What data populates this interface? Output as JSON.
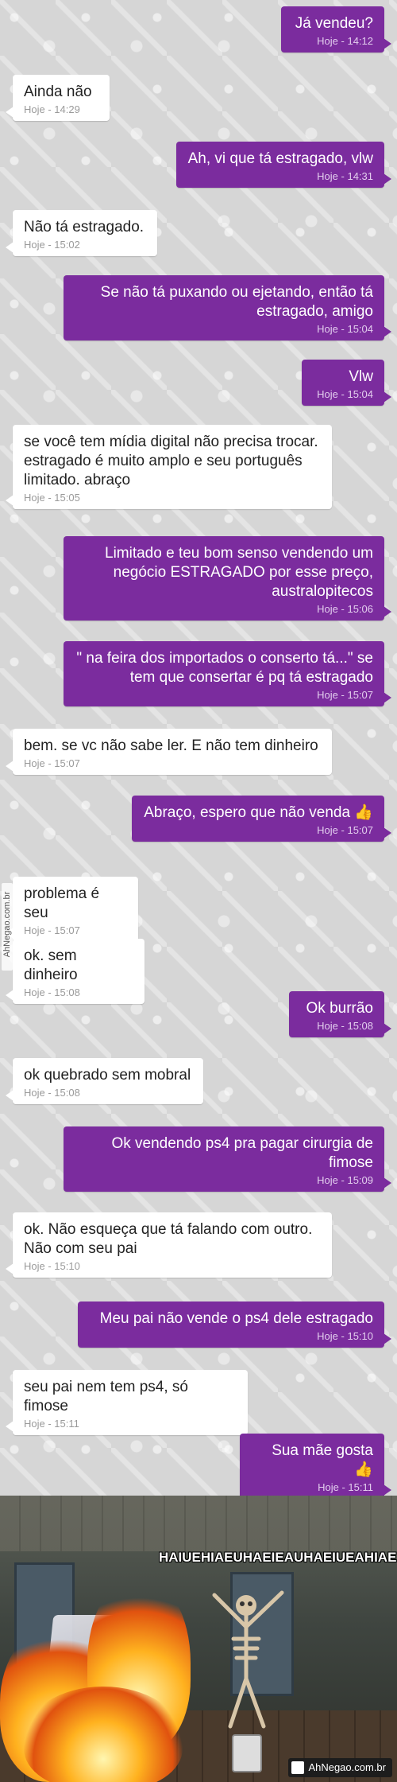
{
  "chat": {
    "messages": [
      {
        "side": "out",
        "text": "Já vendeu?",
        "time": "Hoje - 14:12"
      },
      {
        "side": "in",
        "text": "Ainda não",
        "time": "Hoje - 14:29"
      },
      {
        "side": "out",
        "text": "Ah, vi que tá estragado, vlw",
        "time": "Hoje - 14:31"
      },
      {
        "side": "in",
        "text": "Não tá estragado.",
        "time": "Hoje - 15:02"
      },
      {
        "side": "out",
        "text": "Se não tá puxando ou ejetando, então tá estragado, amigo",
        "time": "Hoje - 15:04"
      },
      {
        "side": "out",
        "text": "Vlw",
        "time": "Hoje - 15:04"
      },
      {
        "side": "in",
        "text": "se você tem mídia digital não precisa trocar. estragado é muito amplo e seu português limitado. abraço",
        "time": "Hoje - 15:05"
      },
      {
        "side": "out",
        "text": "Limitado e teu bom senso vendendo um negócio ESTRAGADO por esse preço, australopitecos",
        "time": "Hoje - 15:06"
      },
      {
        "side": "out",
        "text": "\" na feira dos importados o conserto tá...\" se tem que consertar é pq tá estragado",
        "time": "Hoje - 15:07"
      },
      {
        "side": "in",
        "text": "bem. se vc não sabe ler. E não tem dinheiro",
        "time": "Hoje - 15:07"
      },
      {
        "side": "out",
        "text": "Abraço, espero que não venda 👍",
        "time": "Hoje - 15:07"
      },
      {
        "side": "in",
        "text": "problema é seu",
        "time": "Hoje - 15:07"
      },
      {
        "side": "in",
        "text": "ok. sem dinheiro",
        "time": "Hoje - 15:08"
      },
      {
        "side": "out",
        "text": "Ok burrão",
        "time": "Hoje - 15:08"
      },
      {
        "side": "in",
        "text": "ok quebrado sem mobral",
        "time": "Hoje - 15:08"
      },
      {
        "side": "out",
        "text": "Ok vendendo ps4 pra pagar cirurgia de fimose",
        "time": "Hoje - 15:09"
      },
      {
        "side": "in",
        "text": "ok. Não esqueça que tá falando com outro. Não com seu pai",
        "time": "Hoje - 15:10"
      },
      {
        "side": "out",
        "text": "Meu pai não vende o ps4 dele estragado",
        "time": "Hoje - 15:10"
      },
      {
        "side": "in",
        "text": "seu pai nem tem ps4, só fimose",
        "time": "Hoje - 15:11"
      },
      {
        "side": "out",
        "text": "Sua mãe gosta 👍",
        "time": "Hoje - 15:11"
      }
    ]
  },
  "watermark_side": "AhNegao.com.br",
  "meme": {
    "caption": "HAIUEHIAEUHAEIEAUHAEIUEAHIAE",
    "logo_text": "AhNegao.com.br"
  },
  "colors": {
    "outgoing_bubble": "#7b2c9e",
    "incoming_bubble": "#ffffff",
    "chat_background": "#d6d6d6"
  }
}
